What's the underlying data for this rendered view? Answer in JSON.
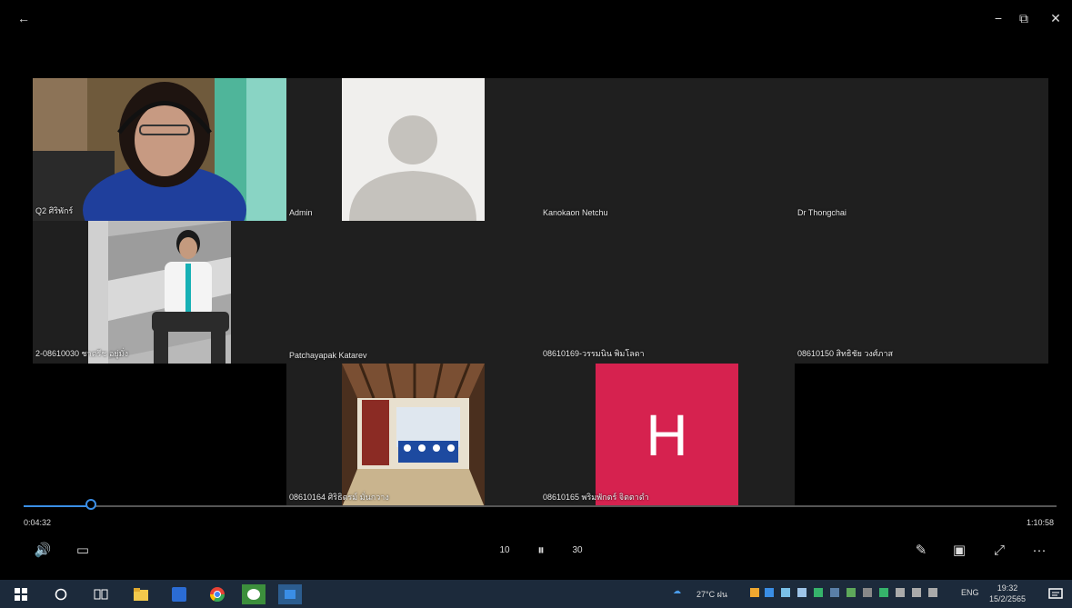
{
  "window": {
    "back_label": "←",
    "minimize_label": "−",
    "restore_label": "⧉",
    "close_label": "✕"
  },
  "participants": [
    {
      "name": "Q2 ศิริพักร์"
    },
    {
      "name": "Admin"
    },
    {
      "name": "Kanokaon Netchu"
    },
    {
      "name": "Dr Thongchai"
    },
    {
      "name": "2-08610030 ชาตรีช อยู่มั่ง"
    },
    {
      "name": "Patchayapak Katarev"
    },
    {
      "name": "08610169-วรรมนิน พิมโลดา"
    },
    {
      "name": "08610150 สิทธิชัย วงศ์ภาส"
    },
    {
      "name": "08610164 ศิริธิตรม์ มั่นกวาง"
    },
    {
      "name": "08610165 พริมพักตร์ จิตตาดำ",
      "initial": "H"
    }
  ],
  "player": {
    "current_time": "0:04:32",
    "total_time": "1:10:58",
    "progress_fraction": 0.064
  },
  "controls": {
    "volume_icon": "🔊",
    "captions_icon": "▭",
    "rewind_label": "10",
    "pause_icon": "⏸",
    "forward_label": "30",
    "edit_icon": "✎",
    "miniplayer_icon": "▣",
    "fullscreen_icon": "⤢",
    "more_label": "···"
  },
  "taskbar": {
    "weather": "27°C ฝน",
    "language": "ENG",
    "time": "19:32",
    "date": "15/2/2565"
  },
  "colors": {
    "accent": "#3a8ee6",
    "avatar_red": "#d6224f",
    "tile_bg": "#1f1f1f"
  }
}
